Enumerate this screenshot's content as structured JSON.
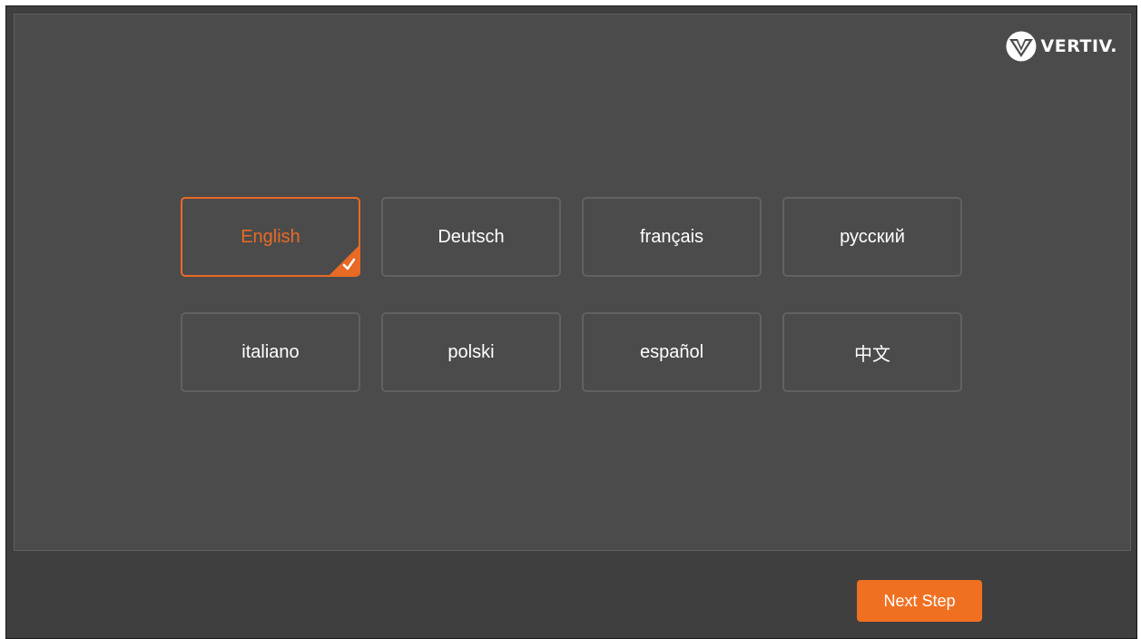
{
  "brand": {
    "name": "VERTIV.",
    "logo_icon": "vertiv-logo-icon"
  },
  "languages": [
    {
      "label": "English",
      "selected": true
    },
    {
      "label": "Deutsch",
      "selected": false
    },
    {
      "label": "français",
      "selected": false
    },
    {
      "label": "русский",
      "selected": false
    },
    {
      "label": "italiano",
      "selected": false
    },
    {
      "label": "polski",
      "selected": false
    },
    {
      "label": "español",
      "selected": false
    },
    {
      "label": "中文",
      "selected": false
    }
  ],
  "footer": {
    "next_label": "Next Step"
  },
  "colors": {
    "accent": "#f07021",
    "selected_text": "#e86a25",
    "panel": "#4b4b4b",
    "footer": "#3f3f3f",
    "tile_border": "#616161"
  }
}
